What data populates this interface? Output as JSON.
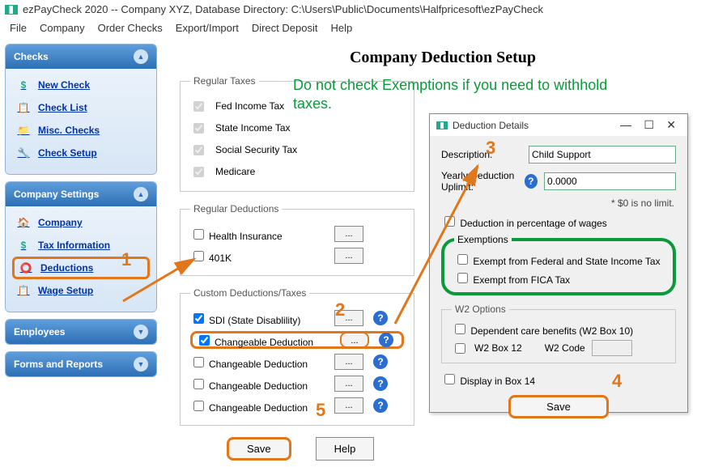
{
  "title": "ezPayCheck 2020 -- Company XYZ, Database Directory: C:\\Users\\Public\\Documents\\Halfpricesoft\\ezPayCheck",
  "menubar": [
    "File",
    "Company",
    "Order Checks",
    "Export/Import",
    "Direct Deposit",
    "Help"
  ],
  "sidebar": {
    "checks": {
      "title": "Checks",
      "items": [
        {
          "label": "New Check",
          "icon": "$"
        },
        {
          "label": "Check List",
          "icon": "📋"
        },
        {
          "label": "Misc. Checks",
          "icon": "📁"
        },
        {
          "label": "Check Setup",
          "icon": "🔧"
        }
      ]
    },
    "company": {
      "title": "Company Settings",
      "items": [
        {
          "label": "Company",
          "icon": "🏠"
        },
        {
          "label": "Tax Information",
          "icon": "$"
        },
        {
          "label": "Deductions",
          "icon": "⭕"
        },
        {
          "label": "Wage Setup",
          "icon": "📋"
        }
      ]
    },
    "employees": {
      "title": "Employees"
    },
    "forms": {
      "title": "Forms and Reports"
    }
  },
  "main": {
    "heading": "Company Deduction Setup",
    "regular_taxes": {
      "legend": "Regular Taxes",
      "items": [
        "Fed Income Tax",
        "State Income Tax",
        "Social Security Tax",
        "Medicare"
      ]
    },
    "regular_deductions": {
      "legend": "Regular Deductions",
      "items": [
        "Health Insurance",
        "401K"
      ]
    },
    "custom": {
      "legend": "Custom Deductions/Taxes",
      "items": [
        {
          "label": "SDI (State Disablility)",
          "checked": true
        },
        {
          "label": "Changeable Deduction",
          "checked": true
        },
        {
          "label": "Changeable Deduction",
          "checked": false
        },
        {
          "label": "Changeable Deduction",
          "checked": false
        },
        {
          "label": "Changeable Deduction",
          "checked": false
        }
      ]
    },
    "buttons": {
      "save": "Save",
      "help": "Help"
    }
  },
  "modal": {
    "title": "Deduction Details",
    "description_label": "Description:",
    "description_value": "Child Support",
    "uplimit_label": "Yearly Deduction Uplimit:",
    "uplimit_value": "0.0000",
    "uplimit_note": "* $0 is no limit.",
    "pct_label": "Deduction in percentage of wages",
    "exemptions": {
      "legend": "Exemptions",
      "fed": "Exempt from Federal and State Income Tax",
      "fica": "Exempt from FICA Tax"
    },
    "w2": {
      "legend": "W2 Options",
      "dep": "Dependent care benefits (W2 Box 10)",
      "box12": "W2 Box 12",
      "code": "W2 Code"
    },
    "box14": "Display in Box 14",
    "save": "Save"
  },
  "annotations": {
    "green": "Do not check Exemptions if you need to withhold taxes.",
    "n1": "1",
    "n2": "2",
    "n3": "3",
    "n4": "4",
    "n5": "5"
  }
}
